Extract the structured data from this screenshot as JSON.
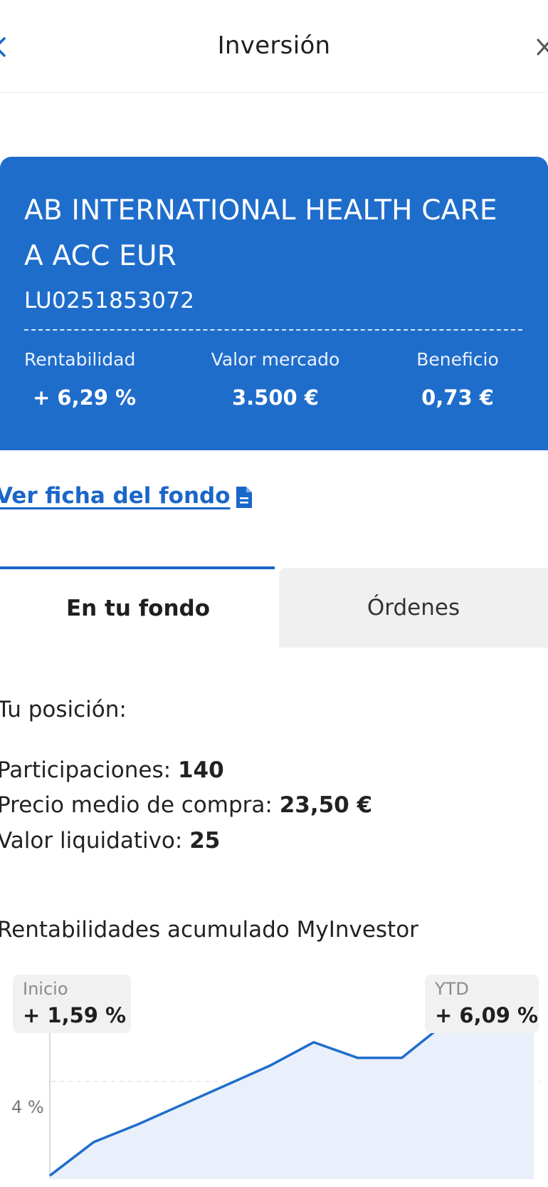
{
  "header": {
    "title": "Inversión"
  },
  "fund": {
    "name": "AB INTERNATIONAL HEALTH CARE A ACC EUR",
    "isin": "LU0251853072",
    "stats": [
      {
        "label": "Rentabilidad",
        "value": "+ 6,29 %"
      },
      {
        "label": "Valor mercado",
        "value": "3.500 €"
      },
      {
        "label": "Beneficio",
        "value": "0,73 €"
      }
    ]
  },
  "links": {
    "fund_sheet": "Ver ficha del fondo"
  },
  "tabs": [
    {
      "label": "En tu fondo",
      "active": true
    },
    {
      "label": "Órdenes",
      "active": false
    }
  ],
  "position": {
    "title": "Tu posición:",
    "rows": [
      {
        "label": "Participaciones:",
        "value": "140"
      },
      {
        "label": "Precio medio de compra:",
        "value": "23,50 €"
      },
      {
        "label": "Valor liquidativo:",
        "value": "25"
      }
    ]
  },
  "returns": {
    "title": "Rentabilidades acumulado MyInvestor",
    "start": {
      "label": "Inicio",
      "value": "+ 1,59 %"
    },
    "ytd": {
      "label": "YTD",
      "value": "+ 6,09 %"
    }
  },
  "chart_data": {
    "type": "area",
    "y_tick_labels": [
      "4 %"
    ],
    "y_ticks": [
      4
    ],
    "ylim": [
      1.5,
      6.6
    ],
    "values": [
      1.59,
      2.45,
      2.9,
      3.4,
      3.9,
      4.4,
      5.0,
      4.6,
      4.6,
      5.5,
      5.7,
      6.09
    ],
    "grid": true
  },
  "colors": {
    "primary": "#1f6dcb",
    "link": "#1a66c9",
    "line": "#1f6dcb",
    "area": "#e9f0fc",
    "tab_inactive": "#f0f0f0"
  },
  "icons": {
    "back": "chevron-left-icon",
    "close": "close-icon",
    "document": "document-icon"
  }
}
